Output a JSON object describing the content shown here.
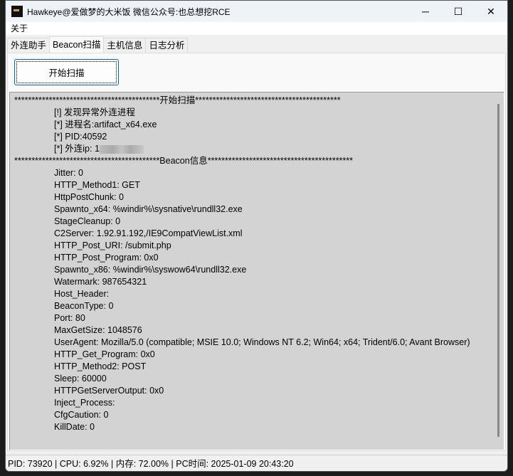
{
  "window": {
    "title": "Hawkeye@爱做梦的大米饭 微信公众号:也总想挖RCE",
    "minimize": "─",
    "maximize": "☐",
    "close": "✕"
  },
  "menu": {
    "about": "关于"
  },
  "tabs": [
    "外连助手",
    "Beacon扫描",
    "主机信息",
    "日志分析"
  ],
  "scan_button": "开始扫描",
  "output": {
    "header1": "******************************************开始扫描******************************************",
    "alert": "[!] 发现异常外连进程",
    "process": "[*] 进程名:artifact_x64.exe",
    "pid": "[*] PID:40592",
    "ip_prefix": "[*] 外连ip: 1",
    "header2": "******************************************Beacon信息******************************************",
    "config": [
      "Jitter: 0",
      "HTTP_Method1: GET",
      "HttpPostChunk: 0",
      "Spawnto_x64: %windir%\\sysnative\\rundll32.exe",
      "StageCleanup: 0",
      "C2Server: 1.92.91.192,/IE9CompatViewList.xml",
      "HTTP_Post_URI: /submit.php",
      "HTTP_Post_Program: 0x0",
      "Spawnto_x86: %windir%\\syswow64\\rundll32.exe",
      "Watermark: 987654321",
      "Host_Header:",
      "BeaconType: 0",
      "Port: 80",
      "MaxGetSize: 1048576",
      "UserAgent: Mozilla/5.0 (compatible; MSIE 10.0; Windows NT 6.2; Win64; x64; Trident/6.0; Avant Browser)",
      "HTTP_Get_Program: 0x0",
      "HTTP_Method2: POST",
      "Sleep: 60000",
      "HTTPGetServerOutput: 0x0",
      "Inject_Process:",
      "CfgCaution: 0",
      "KillDate: 0"
    ]
  },
  "status": "PID: 73920 | CPU: 6.92% | 内存: 72.00% | PC时间: 2025-01-09 20:43:20"
}
